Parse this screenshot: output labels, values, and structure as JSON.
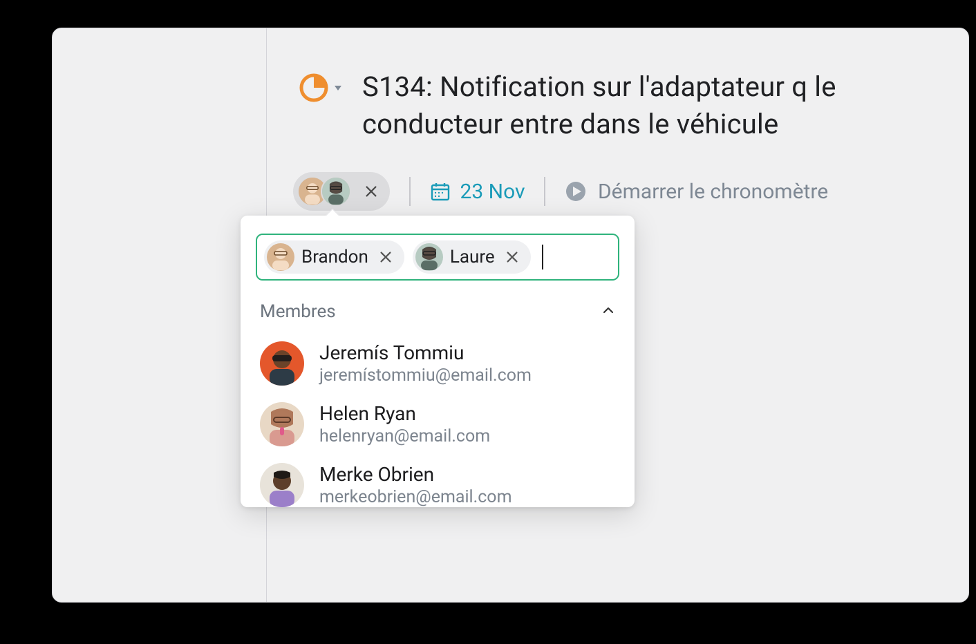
{
  "task": {
    "title": "S134: Notification sur l'adaptateur q le conducteur entre dans le véhicule",
    "status_icon": "pie-quarter-icon",
    "due_date": "23 Nov",
    "timer_label": "Démarrer le chronomètre"
  },
  "assignees": {
    "selected": [
      {
        "name": "Brandon",
        "avatar_color": "#d9b48f"
      },
      {
        "name": "Laure",
        "avatar_color": "#b7cbc2"
      }
    ]
  },
  "popover": {
    "section_label": "Membres",
    "members": [
      {
        "name": "Jeremís Tommiu",
        "email": "jeremístommiu@email.com",
        "avatar_bg": "#e4572b"
      },
      {
        "name": "Helen Ryan",
        "email": "helenryan@email.com",
        "avatar_bg": "#e8d8c5"
      },
      {
        "name": "Merke Obrien",
        "email": "merkeobrien@email.com",
        "avatar_bg": "#b9a3d9"
      }
    ]
  },
  "colors": {
    "accent_orange": "#ef8e2f",
    "accent_teal": "#1a9bb8",
    "input_focus": "#2fb37c"
  }
}
